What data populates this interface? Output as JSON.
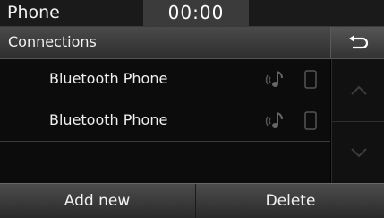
{
  "status_bar": {
    "app_title": "Phone",
    "clock": "00:00"
  },
  "header": {
    "title": "Connections",
    "back_icon": "back-arrow-icon"
  },
  "devices": [
    {
      "name": "Bluetooth Phone",
      "icons": [
        "audio-streaming-icon",
        "phone-icon"
      ]
    },
    {
      "name": "Bluetooth Phone",
      "icons": [
        "audio-streaming-icon",
        "phone-icon"
      ]
    }
  ],
  "scroll": {
    "up_icon": "chevron-up-icon",
    "down_icon": "chevron-down-icon"
  },
  "actions": {
    "add_label": "Add new",
    "delete_label": "Delete"
  },
  "colors": {
    "background": "#000000",
    "bar": "#3b3b3b",
    "icon_dim": "#5a5a5a"
  }
}
